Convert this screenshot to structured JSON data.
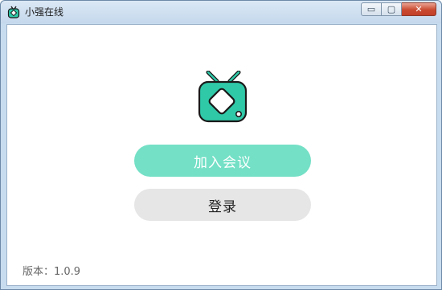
{
  "window": {
    "title": "小强在线",
    "controls": {
      "minimize": "▭",
      "maximize": "▢",
      "close": "✕"
    }
  },
  "main": {
    "logo_icon": "tv-logo-icon",
    "join_button_label": "加入会议",
    "login_button_label": "登录",
    "version_text": "版本：1.0.9"
  },
  "colors": {
    "accent": "#74e0c6",
    "logo_fill": "#2fc9a8",
    "login_bg": "#e6e6e6"
  }
}
